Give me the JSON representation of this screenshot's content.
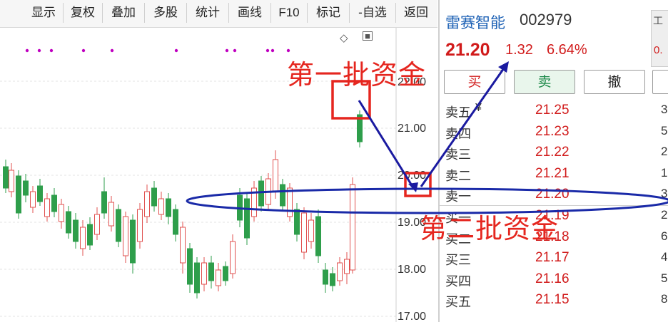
{
  "toolbar": {
    "buttons": [
      "显示",
      "复权",
      "叠加",
      "多股",
      "统计",
      "画线",
      "F10",
      "标记",
      "-自选",
      "返回"
    ]
  },
  "chart": {
    "y_ticks": [
      "22.00",
      "21.00",
      "20.00",
      "19.00",
      "18.00",
      "17.00"
    ],
    "dot_color": "#c000c0",
    "up_color": "#e0504f",
    "down_color": "#2e9e4b"
  },
  "quote": {
    "name": "雷赛智能",
    "code": "002979",
    "price": "21.20",
    "change": "1.32",
    "change_pct": "6.64%",
    "side_tab_label": "工",
    "side_tab_value": "0.",
    "buttons": {
      "buy": "买",
      "sell": "卖",
      "cancel": "撤"
    },
    "order_book": [
      {
        "label": "卖五",
        "price": "21.25",
        "vol": "3"
      },
      {
        "label": "卖四",
        "price": "21.23",
        "vol": "5"
      },
      {
        "label": "卖三",
        "price": "21.22",
        "vol": "2"
      },
      {
        "label": "卖二",
        "price": "21.21",
        "vol": "1"
      },
      {
        "label": "卖一",
        "price": "21.20",
        "vol": "3"
      },
      {
        "label": "买一",
        "price": "21.19",
        "vol": "2"
      },
      {
        "label": "买二",
        "price": "21.18",
        "vol": "6"
      },
      {
        "label": "买三",
        "price": "21.17",
        "vol": "4"
      },
      {
        "label": "买四",
        "price": "21.16",
        "vol": "5"
      },
      {
        "label": "买五",
        "price": "21.15",
        "vol": "8"
      }
    ]
  },
  "annotations": {
    "first_batch": "第一批资金",
    "second_batch": "第二批资金"
  },
  "colors": {
    "annotation_red": "#e5261f",
    "arrow_blue": "#1a1aa0",
    "ellipse_blue": "#1a2aa8"
  }
}
